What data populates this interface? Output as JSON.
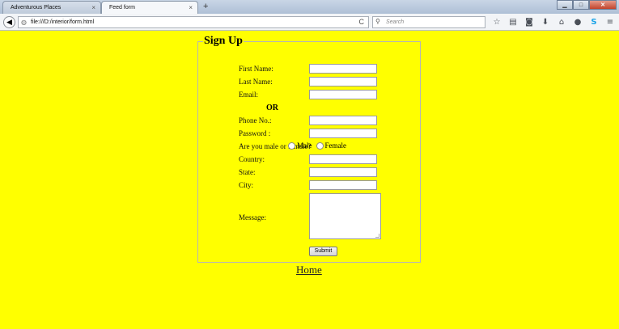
{
  "browser": {
    "tabs": [
      {
        "label": "Adventurous Places",
        "close": "×"
      },
      {
        "label": "Feed form",
        "close": "×"
      }
    ],
    "new_tab": "+",
    "window_controls": {
      "minimize": "▁",
      "maximize": "□",
      "close": "✕"
    },
    "back": "◀",
    "url": "file:///D:/interior/form.html",
    "reload": "C",
    "search_placeholder": "Search",
    "toolbar_icons": [
      "star-icon",
      "reader-icon",
      "pocket-icon",
      "download-icon",
      "home-icon",
      "chat-icon",
      "skype-icon",
      "menu-icon"
    ],
    "toolbar_glyphs": [
      "☆",
      "▤",
      "◙",
      "⬇",
      "⌂",
      "●",
      "S",
      "≡"
    ]
  },
  "form": {
    "legend": "Sign Up",
    "first_name_label": "First Name:",
    "last_name_label": "Last Name:",
    "email_label": "Email:",
    "or_text": "OR",
    "phone_label": "Phone No.:",
    "password_label": "Password :",
    "gender_label": "Are you male or female?",
    "male_label": "Male",
    "female_label": "Female",
    "country_label": "Country:",
    "state_label": "State:",
    "city_label": "City:",
    "message_label": "Message:",
    "submit_label": "Submit"
  },
  "home_link": "Home",
  "colors": {
    "page_background": "#ffff00",
    "fieldset_border": "#b5b5b5"
  }
}
